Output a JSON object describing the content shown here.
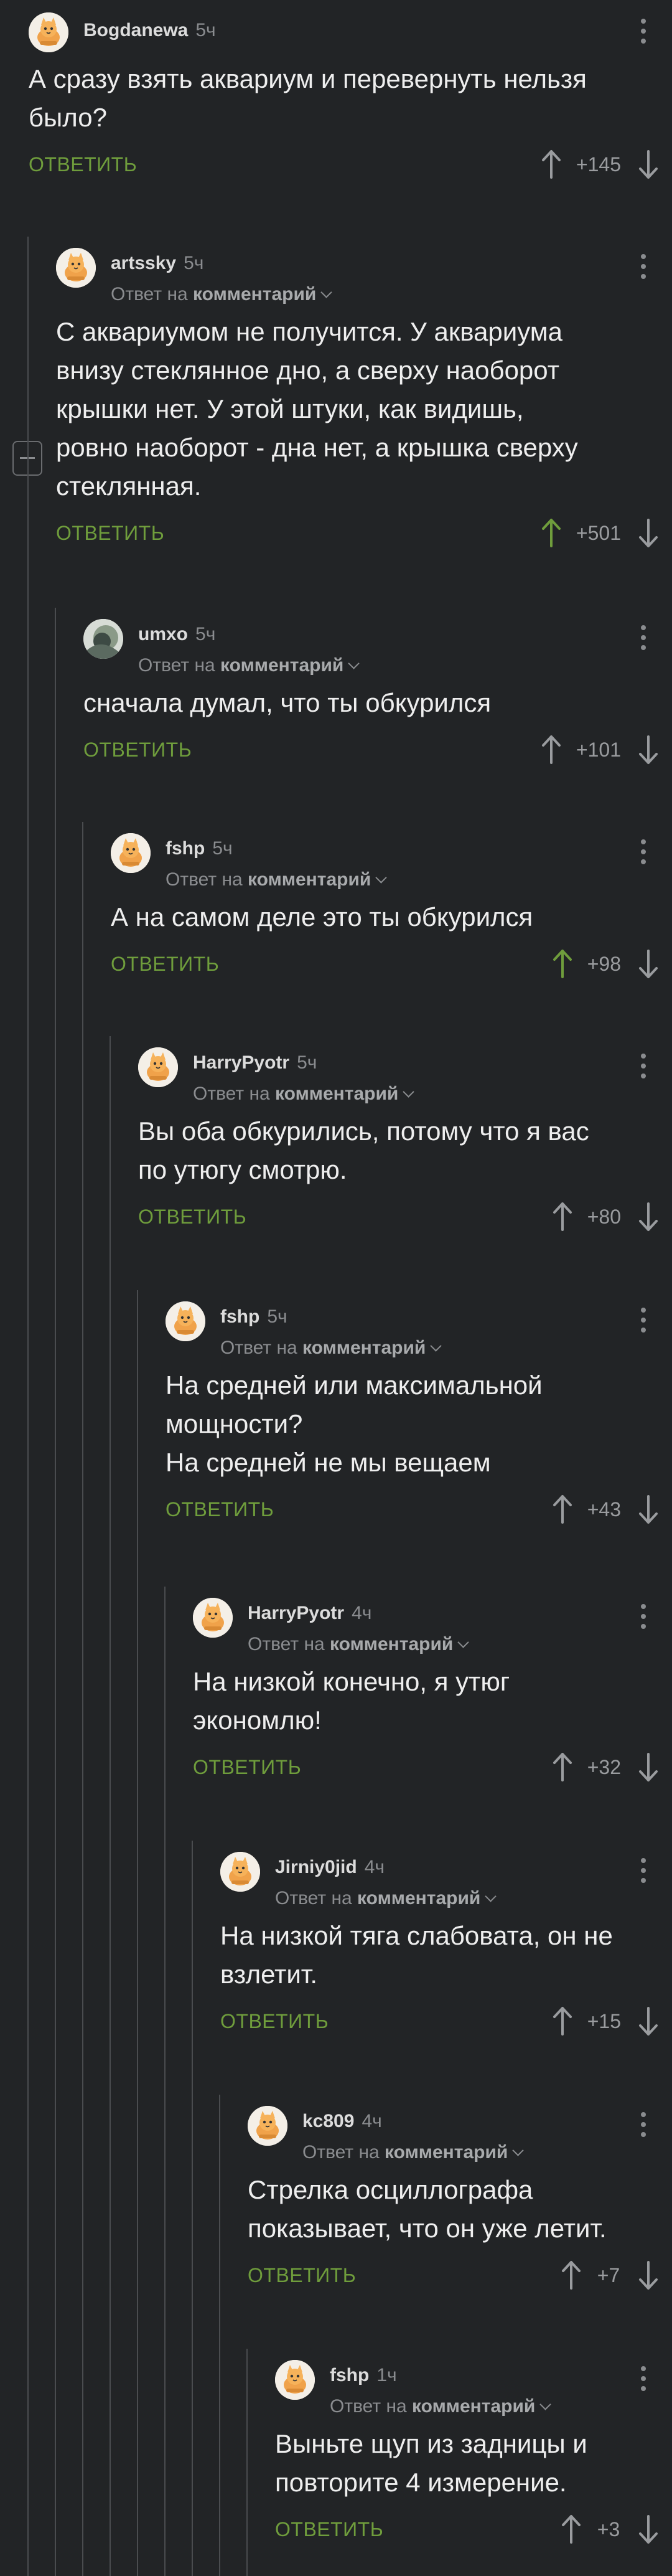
{
  "comments": [
    {
      "user": "Bogdanewa",
      "time": "5ч",
      "reply_to": "",
      "reply_to_link": "",
      "text": [
        "А сразу взять аквариум и перевернуть нельзя",
        "было?"
      ],
      "reply": "ОТВЕТИТЬ",
      "score": "+145",
      "upvoted": false,
      "avatar": "cat"
    },
    {
      "user": "artssky",
      "time": "5ч",
      "reply_to": "Ответ на",
      "reply_to_link": "комментарий",
      "text": [
        "С аквариумом не получится. У аквариума",
        "внизу стеклянное дно, а сверху наоборот",
        "крышки нет. У этой штуки, как видишь,",
        "ровно наоборот - дна нет, а крышка сверху",
        "стеклянная."
      ],
      "reply": "ОТВЕТИТЬ",
      "score": "+501",
      "upvoted": true,
      "avatar": "cat"
    },
    {
      "user": "umxo",
      "time": "5ч",
      "reply_to": "Ответ на",
      "reply_to_link": "комментарий",
      "text": [
        "сначала думал, что ты обкурился"
      ],
      "reply": "ОТВЕТИТЬ",
      "score": "+101",
      "upvoted": false,
      "avatar": "photo"
    },
    {
      "user": "fshp",
      "time": "5ч",
      "reply_to": "Ответ на",
      "reply_to_link": "комментарий",
      "text": [
        "А на самом деле это ты обкурился"
      ],
      "reply": "ОТВЕТИТЬ",
      "score": "+98",
      "upvoted": true,
      "avatar": "cat"
    },
    {
      "user": "HarryPyotr",
      "time": "5ч",
      "reply_to": "Ответ на",
      "reply_to_link": "комментарий",
      "text": [
        "Вы оба обкурились, потому что я вас",
        "по утюгу смотрю."
      ],
      "reply": "ОТВЕТИТЬ",
      "score": "+80",
      "upvoted": false,
      "avatar": "cat"
    },
    {
      "user": "fshp",
      "time": "5ч",
      "reply_to": "Ответ на",
      "reply_to_link": "комментарий",
      "text": [
        "На средней или максимальной",
        "мощности?",
        "На средней не мы вещаем"
      ],
      "reply": "ОТВЕТИТЬ",
      "score": "+43",
      "upvoted": false,
      "avatar": "cat"
    },
    {
      "user": "HarryPyotr",
      "time": "4ч",
      "reply_to": "Ответ на",
      "reply_to_link": "комментарий",
      "text": [
        "На низкой конечно, я утюг",
        "экономлю!"
      ],
      "reply": "ОТВЕТИТЬ",
      "score": "+32",
      "upvoted": false,
      "avatar": "cat"
    },
    {
      "user": "Jirniy0jid",
      "time": "4ч",
      "reply_to": "Ответ на",
      "reply_to_link": "комментарий",
      "text": [
        "На низкой тяга слабовата, он не",
        "взлетит."
      ],
      "reply": "ОТВЕТИТЬ",
      "score": "+15",
      "upvoted": false,
      "avatar": "cat"
    },
    {
      "user": "kc809",
      "time": "4ч",
      "reply_to": "Ответ на",
      "reply_to_link": "комментарий",
      "text": [
        "Стрелка осциллографа",
        "показывает, что он уже летит."
      ],
      "reply": "ОТВЕТИТЬ",
      "score": "+7",
      "upvoted": false,
      "avatar": "cat"
    },
    {
      "user": "fshp",
      "time": "1ч",
      "reply_to": "Ответ на",
      "reply_to_link": "комментарий",
      "text": [
        "Выньте щуп из задницы и",
        "повторите 4 измерение."
      ],
      "reply": "ОТВЕТИТЬ",
      "score": "+3",
      "upvoted": false,
      "avatar": "cat"
    }
  ],
  "colors": {
    "background": "#222426",
    "reply": "#6f9d3c",
    "upvoted": "#6f9d3c",
    "muted": "#8a8c8f",
    "thread_line": "#4a4c4f"
  },
  "icons": {
    "up": "arrow-up-icon",
    "down": "arrow-down-icon",
    "more": "more-vertical-icon",
    "collapse": "collapse-minus-icon"
  }
}
